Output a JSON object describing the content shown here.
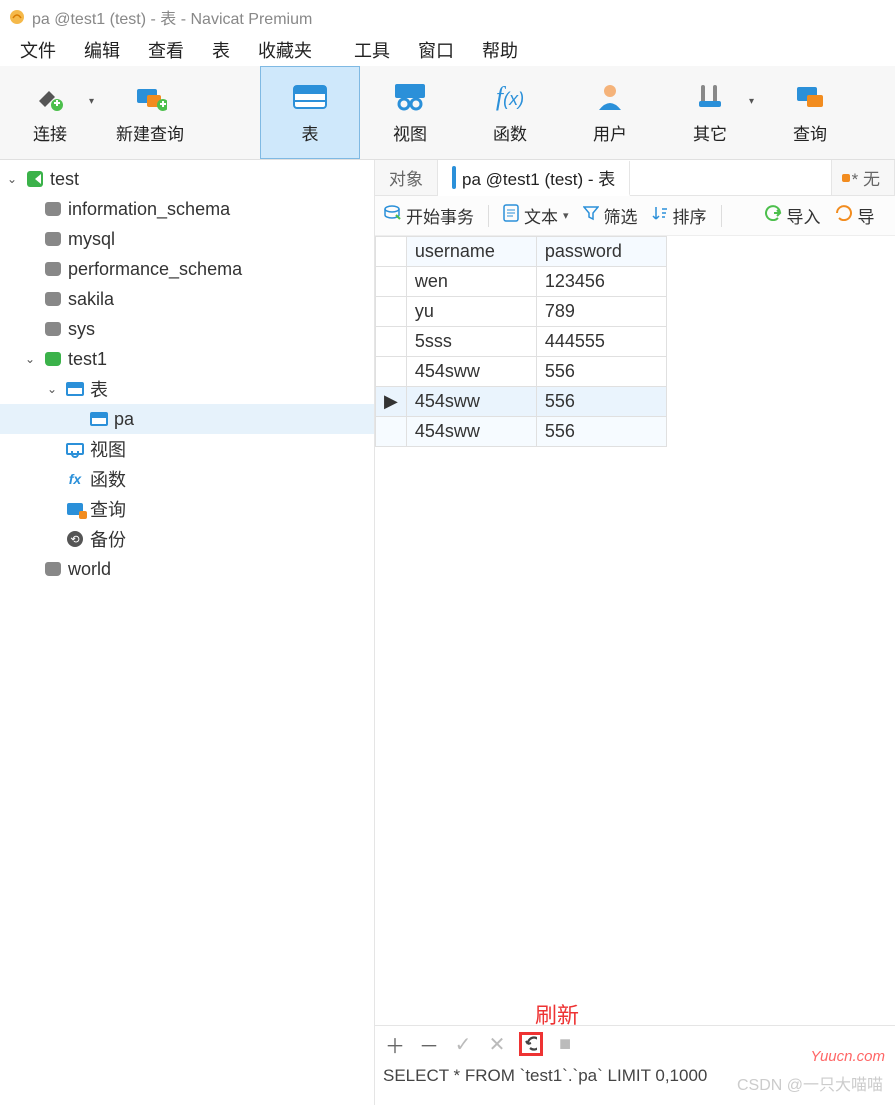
{
  "window": {
    "title": "pa @test1 (test) - 表 - Navicat Premium"
  },
  "menubar": [
    "文件",
    "编辑",
    "查看",
    "表",
    "收藏夹",
    "工具",
    "窗口",
    "帮助"
  ],
  "toolbar": [
    {
      "label": "连接",
      "name": "connect",
      "dropdown": true
    },
    {
      "label": "新建查询",
      "name": "new-query"
    },
    {
      "label": "表",
      "name": "table",
      "active": true
    },
    {
      "label": "视图",
      "name": "view"
    },
    {
      "label": "函数",
      "name": "function"
    },
    {
      "label": "用户",
      "name": "user"
    },
    {
      "label": "其它",
      "name": "other",
      "dropdown": true
    },
    {
      "label": "查询",
      "name": "query"
    }
  ],
  "tree": {
    "root": {
      "label": "test",
      "expanded": true
    },
    "databases": [
      {
        "label": "information_schema"
      },
      {
        "label": "mysql"
      },
      {
        "label": "performance_schema"
      },
      {
        "label": "sakila"
      },
      {
        "label": "sys"
      }
    ],
    "activeDb": {
      "label": "test1",
      "expanded": true
    },
    "tablesNode": {
      "label": "表",
      "expanded": true
    },
    "tables": [
      {
        "label": "pa",
        "selected": true
      }
    ],
    "siblings": [
      {
        "label": "视图",
        "icon": "view"
      },
      {
        "label": "函数",
        "icon": "fx"
      },
      {
        "label": "查询",
        "icon": "query"
      },
      {
        "label": "备份",
        "icon": "backup"
      }
    ],
    "lastDb": {
      "label": "world"
    }
  },
  "tabs": {
    "obj": "对象",
    "data": "pa @test1 (test) - 表",
    "extra": "* 无"
  },
  "tabletoolbar": {
    "begin": "开始事务",
    "text": "文本",
    "filter": "筛选",
    "sort": "排序",
    "import": "导入",
    "export": "导"
  },
  "grid": {
    "columns": [
      "username",
      "password"
    ],
    "rows": [
      {
        "c": [
          "wen",
          "123456"
        ]
      },
      {
        "c": [
          "yu",
          "789"
        ]
      },
      {
        "c": [
          "5sss",
          "444555"
        ]
      },
      {
        "c": [
          "454sww",
          "556"
        ]
      },
      {
        "c": [
          "454sww",
          "556"
        ],
        "active": true
      },
      {
        "c": [
          "454sww",
          "556"
        ],
        "alt": true
      }
    ]
  },
  "footer": {
    "annotation": "刷新",
    "sql": "SELECT * FROM `test1`.`pa` LIMIT 0,1000"
  },
  "watermarks": {
    "site": "Yuucn.com",
    "csdn": "CSDN @一只大喵喵"
  }
}
